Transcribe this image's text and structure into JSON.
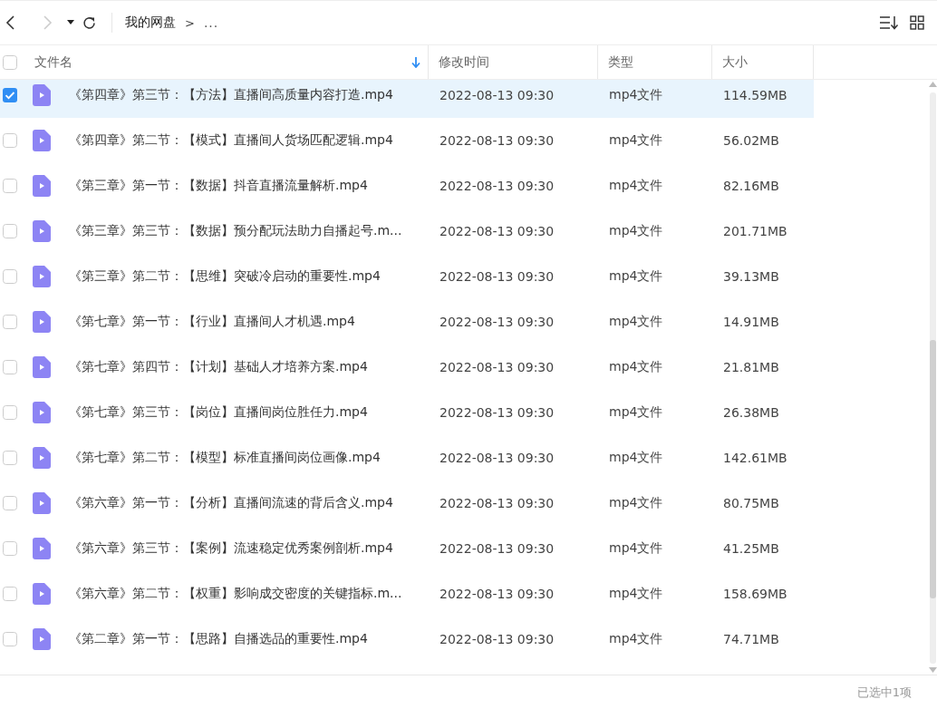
{
  "toolbar": {
    "back_disabled": false,
    "forward_disabled": true,
    "breadcrumb": [
      {
        "kind": "link",
        "text": "我的网盘"
      },
      {
        "kind": "sep",
        "text": ">"
      },
      {
        "kind": "more",
        "text": "..."
      }
    ]
  },
  "table": {
    "select_all": {
      "checked": false
    },
    "columns": [
      {
        "label": "文件名",
        "sorted": true
      },
      {
        "label": "修改时间",
        "sorted": false
      },
      {
        "label": "类型",
        "sorted": false
      },
      {
        "label": "大小",
        "sorted": false
      }
    ],
    "rows": [
      {
        "selected": true,
        "name": "《第四章》第三节：【方法】直播间高质量内容打造.mp4",
        "modified": "2022-08-13 09:30",
        "type": "mp4文件",
        "size": "114.59MB"
      },
      {
        "selected": false,
        "name": "《第四章》第二节：【模式】直播间人货场匹配逻辑.mp4",
        "modified": "2022-08-13 09:30",
        "type": "mp4文件",
        "size": "56.02MB"
      },
      {
        "selected": false,
        "name": "《第三章》第一节：【数据】抖音直播流量解析.mp4",
        "modified": "2022-08-13 09:30",
        "type": "mp4文件",
        "size": "82.16MB"
      },
      {
        "selected": false,
        "name": "《第三章》第三节：【数据】预分配玩法助力自播起号.m...",
        "modified": "2022-08-13 09:30",
        "type": "mp4文件",
        "size": "201.71MB"
      },
      {
        "selected": false,
        "name": "《第三章》第二节：【思维】突破冷启动的重要性.mp4",
        "modified": "2022-08-13 09:30",
        "type": "mp4文件",
        "size": "39.13MB"
      },
      {
        "selected": false,
        "name": "《第七章》第一节：【行业】直播间人才机遇.mp4",
        "modified": "2022-08-13 09:30",
        "type": "mp4文件",
        "size": "14.91MB"
      },
      {
        "selected": false,
        "name": "《第七章》第四节：【计划】基础人才培养方案.mp4",
        "modified": "2022-08-13 09:30",
        "type": "mp4文件",
        "size": "21.81MB"
      },
      {
        "selected": false,
        "name": "《第七章》第三节：【岗位】直播间岗位胜任力.mp4",
        "modified": "2022-08-13 09:30",
        "type": "mp4文件",
        "size": "26.38MB"
      },
      {
        "selected": false,
        "name": "《第七章》第二节：【模型】标准直播间岗位画像.mp4",
        "modified": "2022-08-13 09:30",
        "type": "mp4文件",
        "size": "142.61MB"
      },
      {
        "selected": false,
        "name": "《第六章》第一节：【分析】直播间流速的背后含义.mp4",
        "modified": "2022-08-13 09:30",
        "type": "mp4文件",
        "size": "80.75MB"
      },
      {
        "selected": false,
        "name": "《第六章》第三节：【案例】流速稳定优秀案例剖析.mp4",
        "modified": "2022-08-13 09:30",
        "type": "mp4文件",
        "size": "41.25MB"
      },
      {
        "selected": false,
        "name": "《第六章》第二节：【权重】影响成交密度的关键指标.m...",
        "modified": "2022-08-13 09:30",
        "type": "mp4文件",
        "size": "158.69MB"
      },
      {
        "selected": false,
        "name": "《第二章》第一节：【思路】自播选品的重要性.mp4",
        "modified": "2022-08-13 09:30",
        "type": "mp4文件",
        "size": "74.71MB"
      }
    ]
  },
  "status_bar": {
    "text": "已选中1项"
  }
}
